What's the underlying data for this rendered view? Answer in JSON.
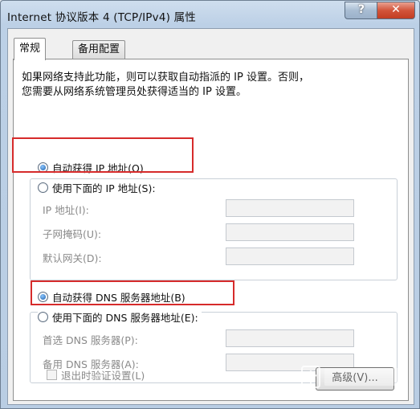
{
  "window": {
    "title": "Internet 协议版本 4 (TCP/IPv4) 属性",
    "help_label": "?",
    "close_label": "✕"
  },
  "tabs": [
    {
      "label": "常规",
      "active": true
    },
    {
      "label": "备用配置",
      "active": false
    }
  ],
  "intro": {
    "line1": "如果网络支持此功能，则可以获取自动指派的 IP 设置。否则，",
    "line2": "您需要从网络系统管理员处获得适当的 IP 设置。"
  },
  "ip": {
    "auto_label": "自动获得 IP 地址(O)",
    "auto_selected": true,
    "manual_label": "使用下面的 IP 地址(S):",
    "manual_selected": false,
    "fields": [
      {
        "label": "IP 地址(I):",
        "value": ""
      },
      {
        "label": "子网掩码(U):",
        "value": ""
      },
      {
        "label": "默认网关(D):",
        "value": ""
      }
    ]
  },
  "dns": {
    "auto_label": "自动获得 DNS 服务器地址(B)",
    "auto_selected": true,
    "manual_label": "使用下面的 DNS 服务器地址(E):",
    "manual_selected": false,
    "fields": [
      {
        "label": "首选 DNS 服务器(P):",
        "value": ""
      },
      {
        "label": "备用 DNS 服务器(A):",
        "value": ""
      }
    ]
  },
  "footer": {
    "validate_label": "退出时验证设置(L)",
    "validate_checked": false,
    "advanced_label": "高级(V)..."
  },
  "colors": {
    "highlight": "#d62b2b",
    "titlebar": "#bcd0e6",
    "close": "#c23d22"
  }
}
